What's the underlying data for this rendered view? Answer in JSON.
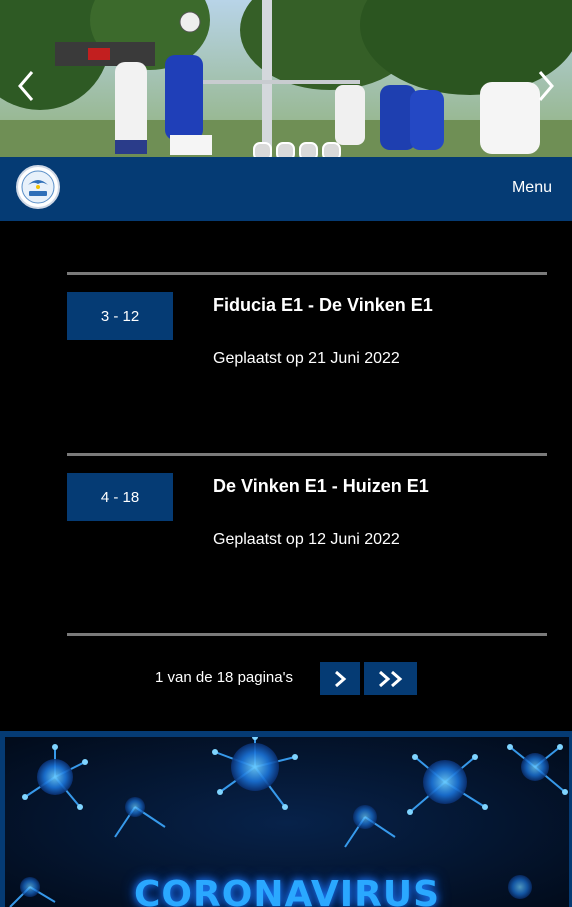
{
  "slider": {
    "prev_icon": "chevron-left-icon",
    "next_icon": "chevron-right-icon",
    "dot_count": 4
  },
  "header": {
    "logo": "club-logo",
    "menu_label": "Menu"
  },
  "articles": [
    {
      "score": "3 - 12",
      "title": "Fiducia E1 - De Vinken E1",
      "date": "Geplaatst op 21 Juni 2022"
    },
    {
      "score": "4 - 18",
      "title": "De Vinken E1 - Huizen E1",
      "date": "Geplaatst op 12 Juni 2022"
    }
  ],
  "pagination": {
    "info": "1 van de 18 pagina's",
    "next_icon": "chevron-right-icon",
    "last_icon": "double-chevron-right-icon"
  },
  "banner": {
    "text": "CORONAVIRUS"
  },
  "colors": {
    "brand_blue": "#053b74",
    "background": "#000000",
    "divider": "#7a7a7a"
  }
}
